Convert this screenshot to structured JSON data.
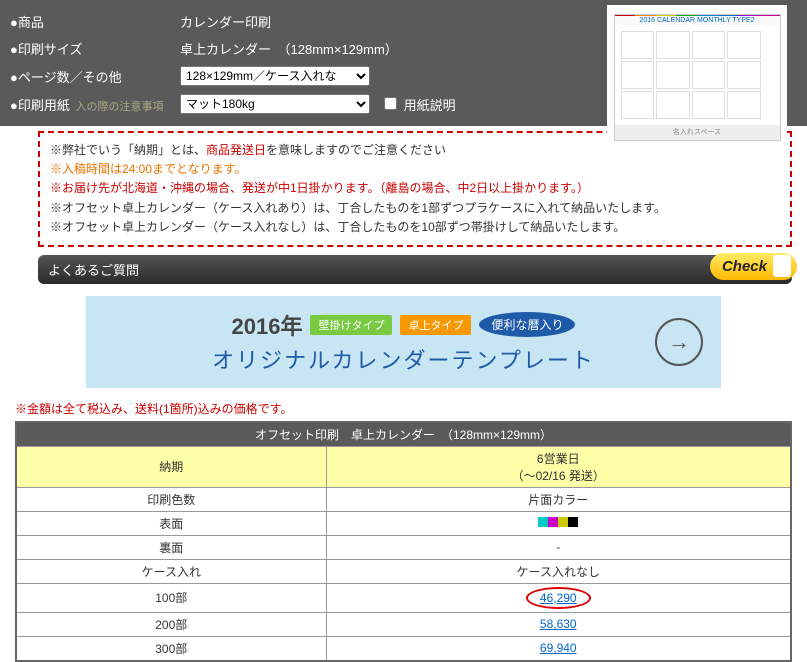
{
  "form": {
    "product_label": "●商品",
    "product_value": "カレンダー印刷",
    "size_label": "●印刷サイズ",
    "size_value": "卓上カレンダー　（128mm×129mm）",
    "pages_label": "●ページ数／その他",
    "pages_select": "128×129mm／ケース入れな",
    "paper_label": "●印刷用紙",
    "paper_hint": "入の際の注意事項",
    "paper_select": "マット180kg",
    "paper_checkbox": "用紙説明"
  },
  "product_image": {
    "title": "2016 CALENDAR MONTHLY TYPE2",
    "footer": "名入れスペース"
  },
  "notes": {
    "line1a": "※弊社でいう「納期」とは、",
    "line1b": "商品発送日",
    "line1c": "を意味しますのでご注意ください",
    "line2": "※入稿時間は24:00までとなります。",
    "line3": "※お届け先が北海道・沖縄の場合、発送が中1日掛かります。（離島の場合、中2日以上掛かります。）",
    "line4": "※オフセット卓上カレンダー（ケース入れあり）は、丁合したものを1部ずつプラケースに入れて納品いたします。",
    "line5": "※オフセット卓上カレンダー（ケース入れなし）は、丁合したものを10部ずつ帯掛けして納品いたします。"
  },
  "faq": {
    "title": "よくあるご質問",
    "check": "Check"
  },
  "banner": {
    "year": "2016年",
    "tag1": "壁掛けタイプ",
    "tag2": "卓上タイプ",
    "tag3": "便利な暦入り",
    "main": "オリジナルカレンダーテンプレート"
  },
  "price_note": "※金額は全て税込み、送料(1箇所)込みの価格です。",
  "table": {
    "header": "オフセット印刷　卓上カレンダー　（128mm×129mm）",
    "rows": {
      "delivery_label": "納期",
      "delivery_val1": "6営業日",
      "delivery_val2": "（～02/16 発送）",
      "colors_label": "印刷色数",
      "colors_val": "片面カラー",
      "front_label": "表面",
      "back_label": "裏面",
      "back_val": "-",
      "case_label": "ケース入れ",
      "case_val": "ケース入れなし",
      "q100_label": "100部",
      "q100_val": "46,290",
      "q200_label": "200部",
      "q200_val": "58,630",
      "q300_label": "300部",
      "q300_val": "69,940"
    }
  }
}
